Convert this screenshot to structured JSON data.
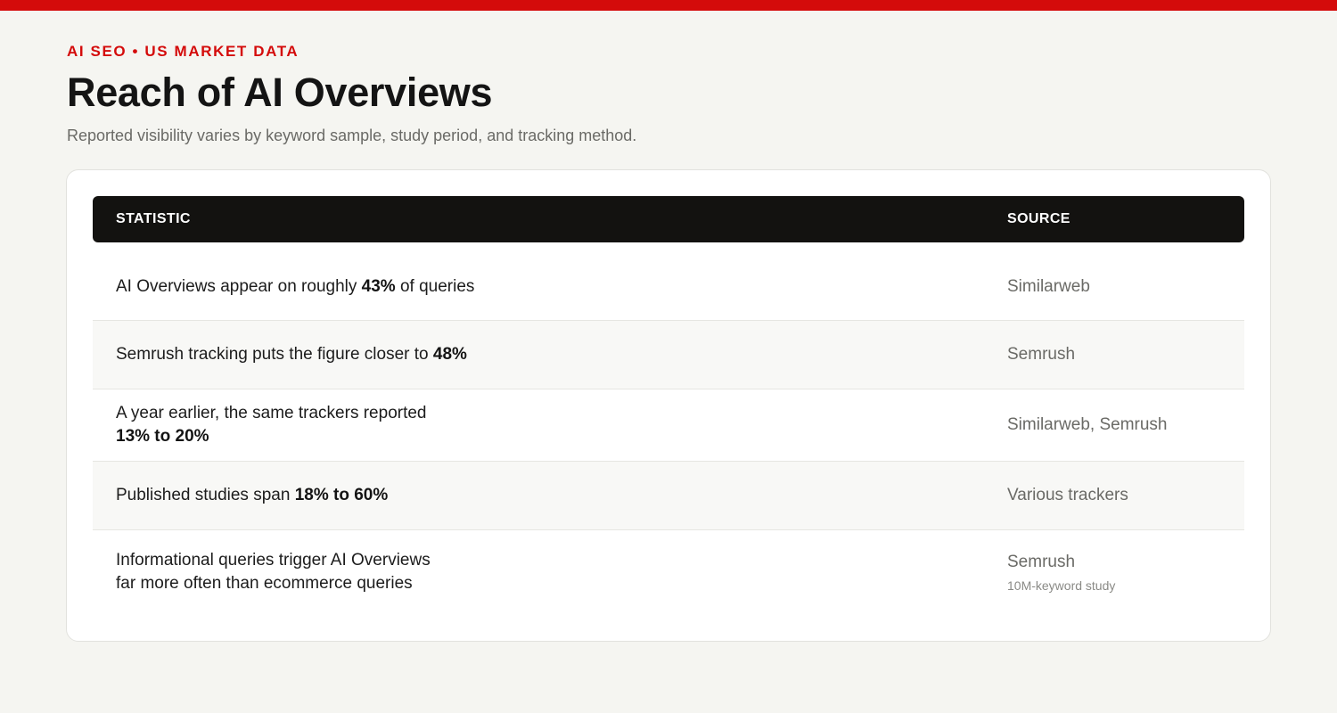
{
  "eyebrow": "AI SEO • US MARKET DATA",
  "title": "Reach of AI Overviews",
  "subtitle": "Reported visibility varies by keyword sample, study period, and tracking method.",
  "table": {
    "headers": {
      "statistic": "STATISTIC",
      "source": "SOURCE"
    },
    "rows": [
      {
        "stat_pre": "AI Overviews appear on roughly ",
        "stat_bold": "43%",
        "stat_post": " of queries",
        "source": "Similarweb"
      },
      {
        "stat_pre": "Semrush tracking puts the figure closer to ",
        "stat_bold": "48%",
        "stat_post": "",
        "source": "Semrush"
      },
      {
        "stat_pre": "A year earlier, the same trackers reported",
        "stat_bold": "13% to 20%",
        "stat_post": "",
        "source": "Similarweb, Semrush"
      },
      {
        "stat_pre": "Published studies span ",
        "stat_bold": "18% to 60%",
        "stat_post": "",
        "source": "Various trackers"
      },
      {
        "stat_line1": "Informational queries trigger AI Overviews",
        "stat_line2": "far more often than ecommerce queries",
        "source": "Semrush",
        "source_note": "10M-keyword study"
      }
    ]
  },
  "colors": {
    "accent": "#d40b0b",
    "header_bg": "#131210",
    "page_bg": "#f5f5f1"
  }
}
